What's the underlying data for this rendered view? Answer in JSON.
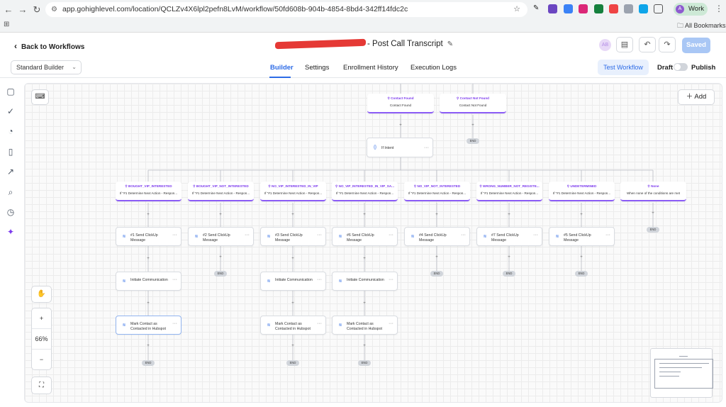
{
  "browser": {
    "url": "app.gohighlevel.com/location/QCLZv4X6lpl2pefn8LvM/workflow/50fd608b-904b-4854-8bd4-342ff14fdc2c",
    "profile_label": "Work",
    "profile_initial": "A",
    "bookmarks_label": "All Bookmarks"
  },
  "header": {
    "back_label": "Back to Workflows",
    "title_suffix": "- Post Call Transcript",
    "avatar_initials": "AB",
    "saved_label": "Saved"
  },
  "tabs_row": {
    "builder_mode": "Standard Builder",
    "tabs": [
      "Builder",
      "Settings",
      "Enrollment History",
      "Execution Logs"
    ],
    "test_label": "Test Workflow",
    "draft_label": "Draft",
    "publish_label": "Publish"
  },
  "canvas": {
    "add_label": "Add",
    "zoom_level": "66%",
    "zoom_in": "+",
    "zoom_out": "−",
    "end_label": "END",
    "top_branches": [
      {
        "title": "Contact Found",
        "sub": "Contact Found"
      },
      {
        "title": "Contact Not Found",
        "sub": "Contact Not Found"
      }
    ],
    "if_node": "If Intent",
    "branches": [
      {
        "title": "BOUGHT_VIP_INTERESTED",
        "sub": "If \"#1 Determine Next Action - Respon...",
        "steps": [
          "#1 Send ClickUp Message",
          "Initiate Communication",
          "Mark Contact as Contacted in Hubspot"
        ]
      },
      {
        "title": "BOUGHT_VIP_NOT_INTERESTED",
        "sub": "If \"#1 Determine Next Action - Respon...",
        "steps": [
          "#2 Send ClickUp Message"
        ]
      },
      {
        "title": "NO_VIP_INTERESTED_IN_VIP",
        "sub": "If \"#1 Determine Next Action - Respon...",
        "steps": [
          "#3 Send ClickUp Message",
          "Initiate Communication",
          "Mark Contact as Contacted in Hubspot"
        ]
      },
      {
        "title": "NO_VIP_INTERESTED_IN_VIP_SA...",
        "sub": "If \"#1 Determine Next Action - Respon...",
        "steps": [
          "#6 Send ClickUp Message",
          "Initiate Communication",
          "Mark Contact as Contacted in Hubspot"
        ]
      },
      {
        "title": "NO_VIP_NOT_INTERESTED",
        "sub": "If \"#1 Determine Next Action - Respon...",
        "steps": [
          "#4 Send ClickUp Message"
        ]
      },
      {
        "title": "WRONG_NUMBER_NOT_REGISTE...",
        "sub": "If \"#1 Determine Next Action - Respon...",
        "steps": [
          "#7 Send ClickUp Message"
        ]
      },
      {
        "title": "UNDETERMINED",
        "sub": "If \"#1 Determine Next Action - Respon...",
        "steps": [
          "#5 Send ClickUp Message"
        ]
      },
      {
        "title": "None",
        "sub": "When none of the conditions are met",
        "steps": []
      }
    ]
  },
  "colors": {
    "accent": "#2d6be6",
    "branch_accent": "#8b5cf6",
    "saved_bg": "#a9c7f5"
  },
  "icons": {
    "rail": [
      "chat-icon",
      "check-circle-icon",
      "pie-chart-icon",
      "document-icon",
      "external-link-icon",
      "search-icon",
      "clock-icon",
      "sparkle-icon"
    ]
  }
}
